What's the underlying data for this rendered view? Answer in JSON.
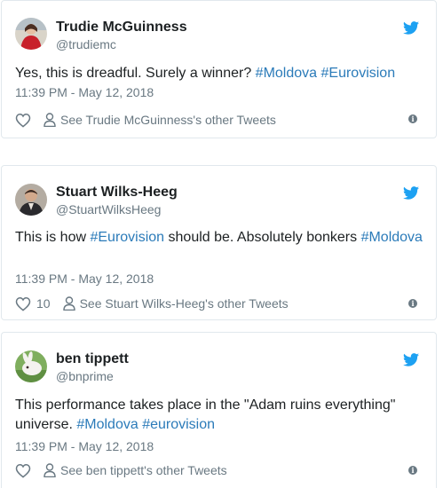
{
  "tweets": [
    {
      "name": "Trudie McGuinness",
      "handle": "@trudiemc",
      "text_parts": [
        "Yes, this is dreadful. Surely a winner? ",
        "#Moldova",
        " ",
        "#Eurovision"
      ],
      "timestamp": "11:39 PM - May 12, 2018",
      "likes": "",
      "other_tweets": "See Trudie McGuinness's other Tweets",
      "avatar_icon": "woman-red-dress-avatar"
    },
    {
      "name": "Stuart Wilks-Heeg",
      "handle": "@StuartWilksHeeg",
      "text_parts": [
        "This is how ",
        "#Eurovision",
        " should be. Absolutely bonkers ",
        "#Moldova"
      ],
      "timestamp": "11:39 PM - May 12, 2018",
      "likes": "10",
      "other_tweets": "See Stuart Wilks-Heeg's other Tweets",
      "avatar_icon": "man-portrait-avatar"
    },
    {
      "name": "ben tippett",
      "handle": "@bnprime",
      "text_parts": [
        "This performance takes place in the \"Adam ruins everything\" universe. ",
        "#Moldova",
        " ",
        "#eurovision"
      ],
      "timestamp": "11:39 PM - May 12, 2018",
      "likes": "",
      "other_tweets": "See ben tippett's other Tweets",
      "avatar_icon": "rabbit-avatar"
    }
  ],
  "colors": {
    "hashtag": "#2b7bb9",
    "twitter_blue": "#1da1f2",
    "muted": "#697882",
    "text": "#1c2022",
    "border": "#e1e8ed"
  },
  "icons": {
    "brand": "twitter-bird-icon",
    "like": "heart-icon",
    "profile": "person-icon",
    "info": "info-icon"
  },
  "info_glyph": "i"
}
